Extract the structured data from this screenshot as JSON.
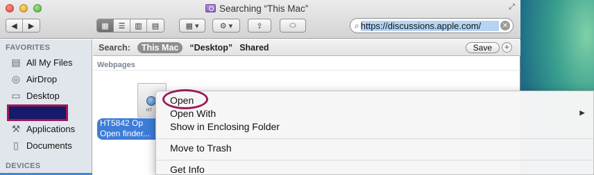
{
  "window": {
    "title": "Searching “This Mac”"
  },
  "toolbar": {
    "back_icon": "◀",
    "forward_icon": "▶",
    "view_icons": [
      "▦",
      "☰",
      "▥",
      "▤"
    ],
    "arrange_icon": "▦ ▾",
    "action_icon": "⚙ ▾",
    "share_icon": "⇪",
    "tag_icon": "⬭"
  },
  "search": {
    "value": "https://discussions.apple.com/",
    "clear_icon": "✕"
  },
  "sidebar": {
    "favorites_heading": "FAVORITES",
    "items": [
      {
        "label": "All My Files",
        "icon": "▤"
      },
      {
        "label": "AirDrop",
        "icon": "◎"
      },
      {
        "label": "Desktop",
        "icon": "▭"
      },
      {
        "label": "Applications",
        "icon": "⚒"
      },
      {
        "label": "Documents",
        "icon": "▯"
      }
    ],
    "devices_heading": "DEVICES"
  },
  "scope": {
    "label": "Search:",
    "this_mac": "This Mac",
    "desktop": "“Desktop”",
    "shared": "Shared",
    "save": "Save",
    "plus": "+"
  },
  "results": {
    "section": "Webpages",
    "file_icon_tag": "HT",
    "file_line1": "HT5842 Op",
    "file_line2": "Open finder..."
  },
  "context_menu": {
    "items": [
      "Open",
      "Open With",
      "Show in Enclosing Folder",
      "Move to Trash",
      "Get Info"
    ],
    "submenu_arrow": "▶"
  },
  "colors": {
    "annotation": "#9b1a56",
    "selection": "#3d7dd8",
    "redaction": "#161a6b"
  }
}
